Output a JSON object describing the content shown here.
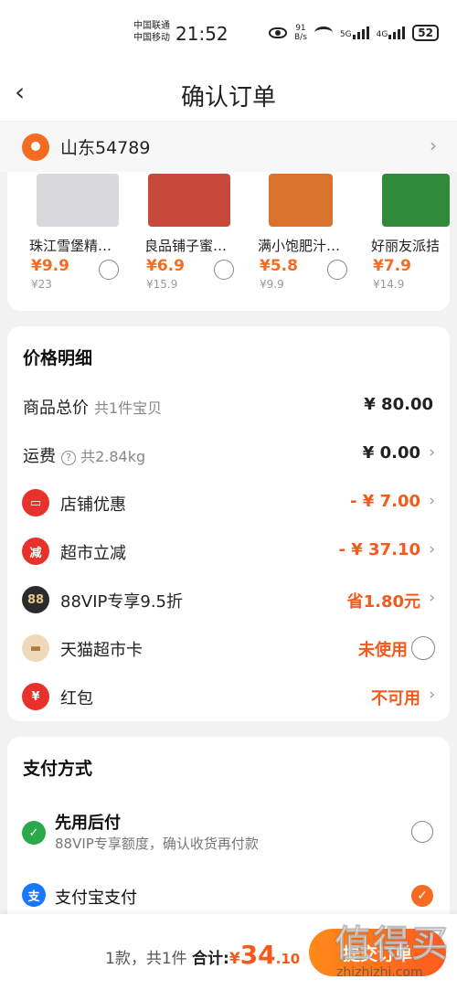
{
  "status_bar": {
    "carrier1": "中国联通",
    "carrier2": "中国移动",
    "time": "21:52",
    "net_speed_value": "91",
    "net_speed_unit": "B/s",
    "sig1": "5G",
    "sig2": "4G",
    "battery": "52"
  },
  "header": {
    "back": "‹",
    "title": "确认订单"
  },
  "address": {
    "text": "山东54789",
    "arrow": "›"
  },
  "products": [
    {
      "name": "珠江雪堡精…",
      "price": "¥9.9",
      "orig": "¥23",
      "color": "#d9d9dc"
    },
    {
      "name": "良品铺子蜜…",
      "price": "¥6.9",
      "orig": "¥15.9",
      "color": "#c7493a"
    },
    {
      "name": "满小饱肥汁…",
      "price": "¥5.8",
      "orig": "¥9.9",
      "color": "#d9722a"
    },
    {
      "name": "好丽友派拮",
      "price": "¥7.9",
      "orig": "¥14.9",
      "color": "#2f8a3a"
    }
  ],
  "price_detail": {
    "title": "价格明细",
    "rows": [
      {
        "label": "商品总价",
        "sub": "共1件宝贝",
        "value": "¥ 80.00"
      },
      {
        "label": "运费",
        "sub": "共2.84kg",
        "q": "?",
        "value": "¥ 0.00",
        "arrow": "›"
      },
      {
        "label": "店铺优惠",
        "icon_color": "#e8312b",
        "icon_text": "▭",
        "value": "- ¥ 7.00",
        "arrow": "›"
      },
      {
        "label": "超市立减",
        "icon_color": "#e8312b",
        "icon_text": "减",
        "value": "- ¥ 37.10",
        "arrow": "›"
      },
      {
        "label": "88VIP专享9.5折",
        "icon_color": "#2b2b2b",
        "icon_text": "88",
        "value": "省1.80元",
        "arrow": "›"
      },
      {
        "label": "天猫超市卡",
        "icon_color": "#e9c9a0",
        "icon_text": "▬",
        "value": "未使用"
      },
      {
        "label": "红包",
        "icon_color": "#e8312b",
        "icon_text": "¥",
        "value": "不可用",
        "arrow": "›"
      }
    ]
  },
  "payment": {
    "title": "支付方式",
    "option1": {
      "label": "先用后付",
      "sub": "88VIP专享额度，确认收货再付款",
      "icon_color": "#2aa84a",
      "icon_text": "✓"
    },
    "option2": {
      "label": "支付宝支付",
      "icon_color": "#1677ff",
      "icon_text": "支",
      "check": "✓"
    }
  },
  "bottom_bar": {
    "count": "1款，共1件",
    "total_label": "合计:",
    "currency": "¥",
    "total_int": "34",
    "total_dec": ".10",
    "submit": "提交订单"
  },
  "watermark": {
    "big": "值得买",
    "small": "zhizhizhi.com"
  }
}
